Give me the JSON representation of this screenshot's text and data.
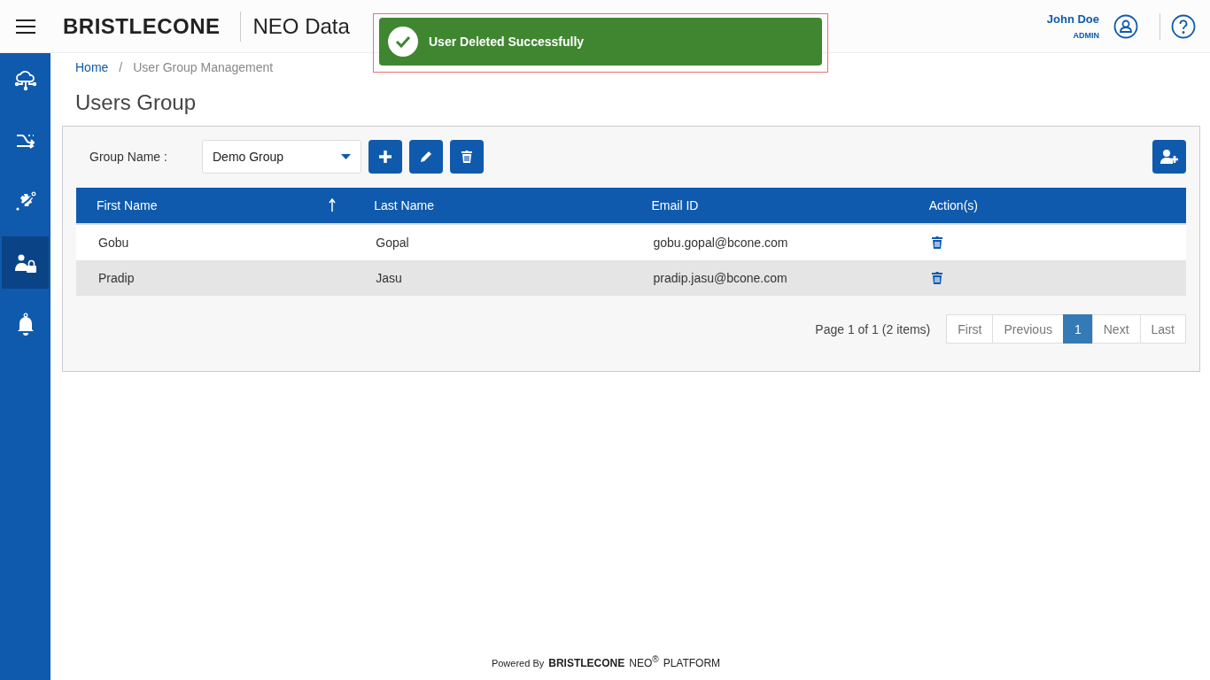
{
  "header": {
    "logo": "BRISTLECONE",
    "title": "NEO Data",
    "user_name": "John Doe",
    "user_role": "ADMIN"
  },
  "toast": {
    "message": "User Deleted Successfully"
  },
  "sidebar": {
    "items": [
      {
        "kind": "cloud",
        "selected": false
      },
      {
        "kind": "flow",
        "selected": false
      },
      {
        "kind": "gear",
        "selected": false
      },
      {
        "kind": "user-lock",
        "selected": true
      },
      {
        "kind": "bell",
        "selected": false
      }
    ]
  },
  "breadcrumb": [
    {
      "label": "Home",
      "kind": "link"
    },
    {
      "label": "/",
      "kind": "separator"
    },
    {
      "label": "User Group Management",
      "kind": "current"
    }
  ],
  "page_title": "Users Group",
  "group_select": {
    "label": "Group Name :",
    "value": "Demo Group"
  },
  "table": {
    "columns": [
      {
        "label": "First Name",
        "sorted": true
      },
      {
        "label": "Last Name",
        "sorted": false
      },
      {
        "label": "Email ID",
        "sorted": false
      },
      {
        "label": "Action(s)",
        "sorted": false
      }
    ],
    "rows": [
      {
        "first_name": "Gobu",
        "last_name": "Gopal",
        "email": "gobu.gopal@bcone.com"
      },
      {
        "first_name": "Pradip",
        "last_name": "Jasu",
        "email": "pradip.jasu@bcone.com"
      }
    ]
  },
  "pagination": {
    "summary": "Page 1 of 1 (2 items)",
    "buttons": [
      {
        "label": "First",
        "selected": false
      },
      {
        "label": "Previous",
        "selected": false
      },
      {
        "label": "1",
        "selected": true
      },
      {
        "label": "Next",
        "selected": false
      },
      {
        "label": "Last",
        "selected": false
      }
    ]
  },
  "footer": {
    "powered_by": "Powered By",
    "brand": "BRISTLECONE",
    "product": "NEO$^{®}$",
    "platform": "PLATFORM"
  }
}
